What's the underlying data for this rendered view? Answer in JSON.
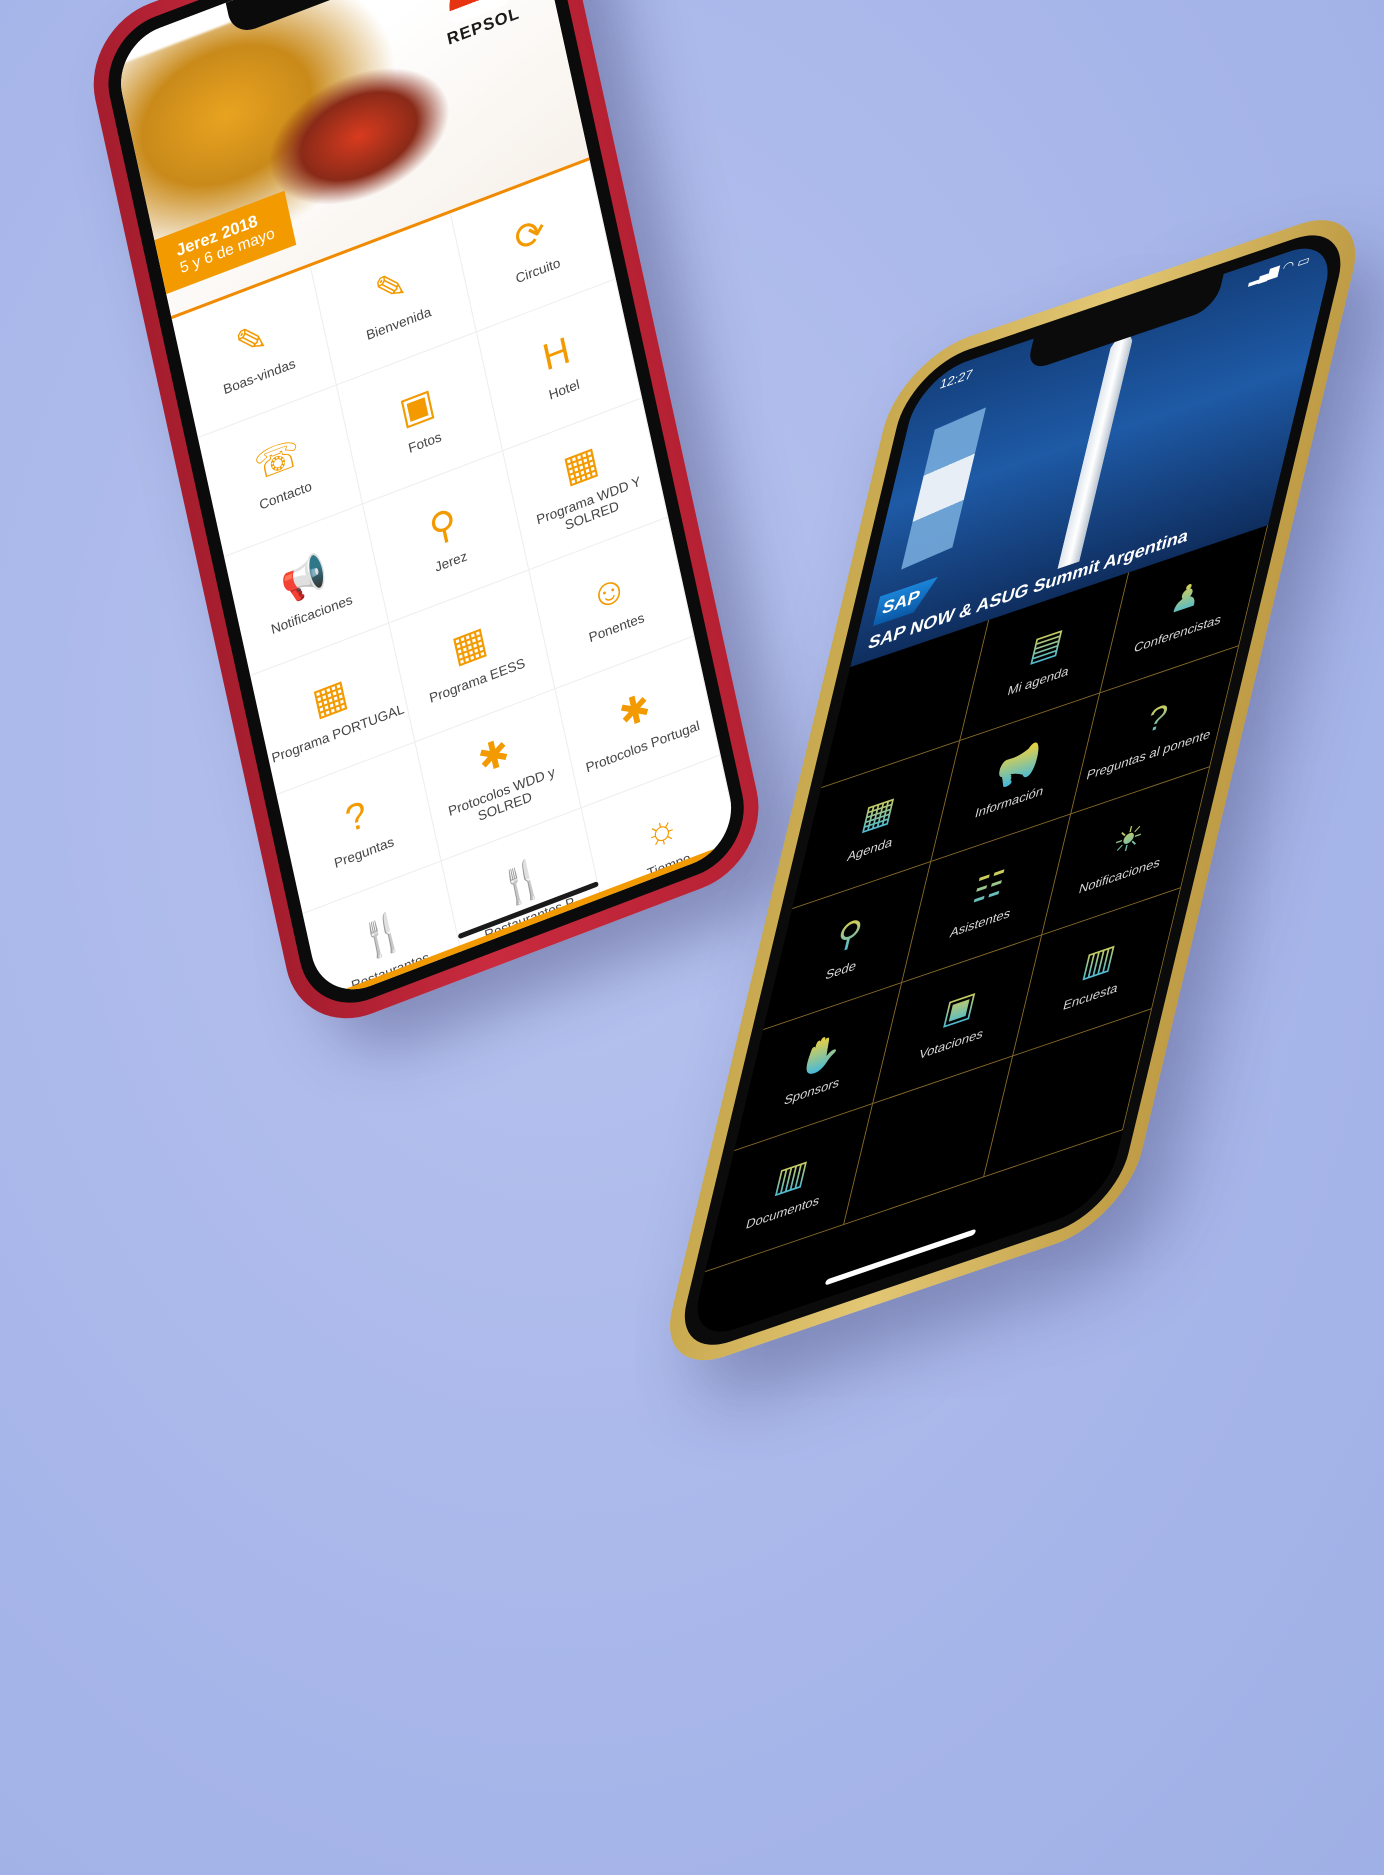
{
  "red_phone": {
    "brand": "REPSOL",
    "event_badge": {
      "line1": "Jerez 2018",
      "line2": "5 y 6 de mayo"
    },
    "tiles": [
      {
        "label": "Boas-vindas",
        "icon": "edit-icon",
        "glyph": "✎"
      },
      {
        "label": "Bienvenida",
        "icon": "edit-icon",
        "glyph": "✎"
      },
      {
        "label": "Circuito",
        "icon": "circuit-icon",
        "glyph": "⟳"
      },
      {
        "label": "Contacto",
        "icon": "phone-icon",
        "glyph": "☏"
      },
      {
        "label": "Fotos",
        "icon": "image-icon",
        "glyph": "▣"
      },
      {
        "label": "Hotel",
        "icon": "hotel-icon",
        "glyph": "H"
      },
      {
        "label": "Notificaciones",
        "icon": "megaphone-icon",
        "glyph": "📢"
      },
      {
        "label": "Jerez",
        "icon": "location-pin-icon",
        "glyph": "⚲"
      },
      {
        "label": "Programa WDD Y SOLRED",
        "icon": "calendar-icon",
        "glyph": "▦"
      },
      {
        "label": "Programa PORTUGAL",
        "icon": "calendar-icon",
        "glyph": "▦"
      },
      {
        "label": "Programa EESS",
        "icon": "calendar-icon",
        "glyph": "▦"
      },
      {
        "label": "Ponentes",
        "icon": "speaker-icon",
        "glyph": "☺"
      },
      {
        "label": "Preguntas",
        "icon": "question-icon",
        "glyph": "?"
      },
      {
        "label": "Protocolos WDD y SOLRED",
        "icon": "protocol-icon",
        "glyph": "✱"
      },
      {
        "label": "Protocolos Portugal",
        "icon": "protocol-icon",
        "glyph": "✱"
      },
      {
        "label": "Restaurantes",
        "icon": "cutlery-icon",
        "glyph": "🍴"
      },
      {
        "label": "Restaurantes P",
        "icon": "cutlery-icon",
        "glyph": "🍴"
      },
      {
        "label": "Tiempo",
        "icon": "sun-icon",
        "glyph": "☼"
      }
    ]
  },
  "gold_phone": {
    "status_time": "12:27",
    "sap_logo": "SAP",
    "event_title": "SAP NOW & ASUG Summit Argentina",
    "tiles": [
      {
        "label": "",
        "icon": "blank",
        "glyph": ""
      },
      {
        "label": "Mi agenda",
        "icon": "mobile-agenda-icon",
        "glyph": "▤"
      },
      {
        "label": "Conferencistas",
        "icon": "presenter-icon",
        "glyph": "♟"
      },
      {
        "label": "Agenda",
        "icon": "calendar-clock-icon",
        "glyph": "▦"
      },
      {
        "label": "Información",
        "icon": "megaphone-icon",
        "glyph": "📢"
      },
      {
        "label": "Preguntas al ponente",
        "icon": "question-icon",
        "glyph": "?"
      },
      {
        "label": "Sede",
        "icon": "location-pin-icon",
        "glyph": "⚲"
      },
      {
        "label": "Asistentes",
        "icon": "people-icon",
        "glyph": "☷"
      },
      {
        "label": "Notificaciones",
        "icon": "notification-icon",
        "glyph": "☀"
      },
      {
        "label": "Sponsors",
        "icon": "handshake-icon",
        "glyph": "✋"
      },
      {
        "label": "Votaciones",
        "icon": "vote-screen-icon",
        "glyph": "▣"
      },
      {
        "label": "Encuesta",
        "icon": "survey-icon",
        "glyph": "▥"
      },
      {
        "label": "Documentos",
        "icon": "documents-icon",
        "glyph": "▥"
      },
      {
        "label": "",
        "icon": "blank",
        "glyph": ""
      },
      {
        "label": "",
        "icon": "blank",
        "glyph": ""
      }
    ]
  }
}
